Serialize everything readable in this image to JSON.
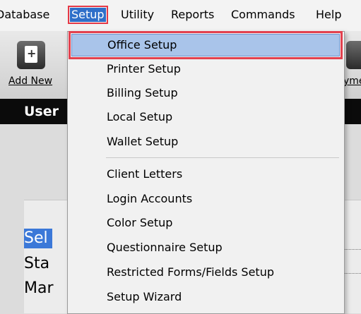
{
  "menubar": {
    "items": [
      {
        "label": "Database",
        "mnemonic": "D"
      },
      {
        "label": "Setup",
        "mnemonic": "S"
      },
      {
        "label": "Utility",
        "mnemonic": "U"
      },
      {
        "label": "Reports",
        "mnemonic": "R"
      },
      {
        "label": "Commands",
        "mnemonic": "C"
      },
      {
        "label": "Help",
        "mnemonic": "H"
      }
    ],
    "selected": "Setup"
  },
  "toolbar": {
    "add_new_label": "Add New",
    "right_label_fragment": "yme"
  },
  "header": {
    "title_fragment": "User"
  },
  "panel": {
    "lines": [
      "Sel",
      "Sta",
      "Mar"
    ]
  },
  "dropdown": {
    "groups": [
      [
        "Office Setup",
        "Printer Setup",
        "Billing Setup",
        "Local Setup",
        "Wallet Setup"
      ],
      [
        "Client Letters",
        "Login Accounts",
        "Color Setup",
        "Questionnaire Setup",
        "Restricted Forms/Fields Setup",
        "Setup Wizard"
      ]
    ],
    "highlighted": "Office Setup"
  },
  "colors": {
    "selection_blue": "#2f6fc9",
    "highlight_item": "#a9c4ea",
    "annotation_red": "#e53946",
    "header_dark": "#0b0b0b"
  }
}
